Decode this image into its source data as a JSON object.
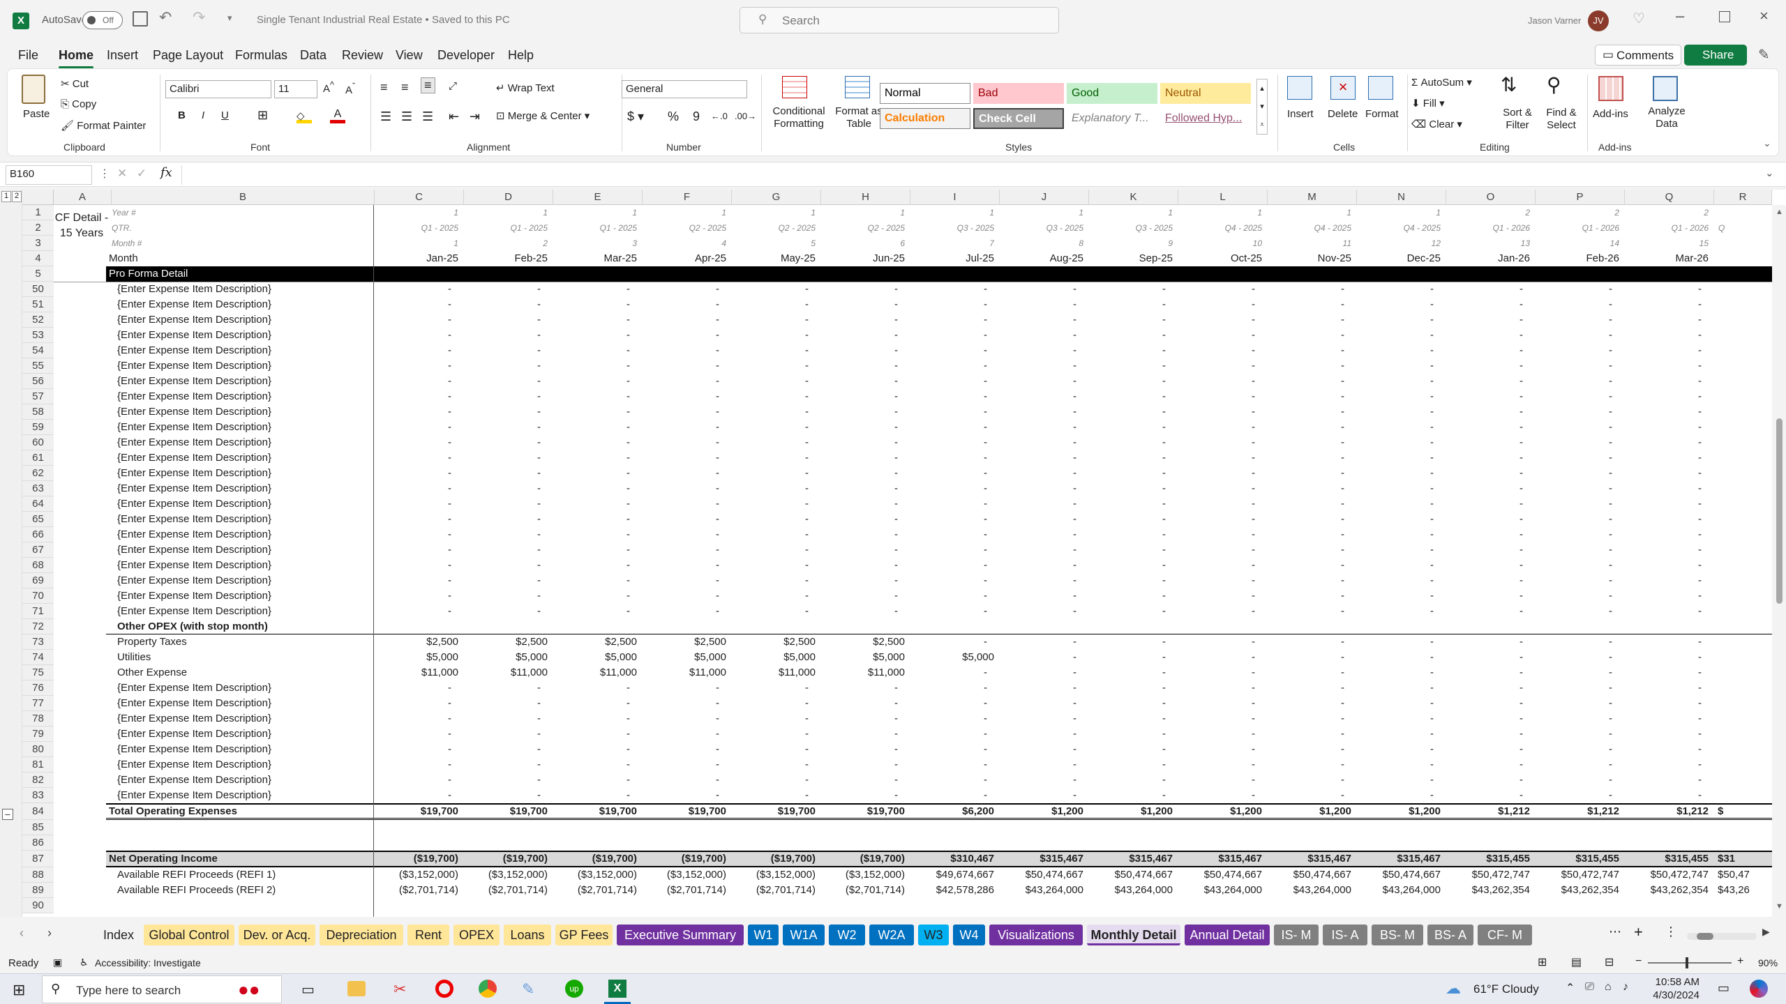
{
  "titlebar": {
    "autosave_label": "AutoSave",
    "autosave_state": "Off",
    "doc_title": "Single Tenant Industrial Real Estate • Saved to this PC",
    "search_placeholder": "Search",
    "user_name": "Jason Varner",
    "user_initials": "JV"
  },
  "menu": {
    "items": [
      "File",
      "Home",
      "Insert",
      "Page Layout",
      "Formulas",
      "Data",
      "Review",
      "View",
      "Developer",
      "Help"
    ],
    "active": "Home",
    "comments_label": "Comments",
    "share_label": "Share"
  },
  "ribbon": {
    "clipboard": {
      "paste": "Paste",
      "cut": "Cut",
      "copy": "Copy",
      "format_painter": "Format Painter",
      "group": "Clipboard"
    },
    "font": {
      "name": "Calibri",
      "size": "11",
      "group": "Font"
    },
    "alignment": {
      "wrap": "Wrap Text",
      "merge": "Merge & Center",
      "group": "Alignment"
    },
    "number": {
      "format": "General",
      "group": "Number"
    },
    "styles": {
      "conditional": "Conditional Formatting",
      "format_table": "Format as Table",
      "items": [
        {
          "label": "Normal",
          "bg": "#ffffff",
          "fg": "#000000",
          "border": "#888888"
        },
        {
          "label": "Bad",
          "bg": "#ffc7ce",
          "fg": "#9c0006",
          "border": "#ffc7ce"
        },
        {
          "label": "Good",
          "bg": "#c6efce",
          "fg": "#006100",
          "border": "#c6efce"
        },
        {
          "label": "Neutral",
          "bg": "#ffeb9c",
          "fg": "#9c5700",
          "border": "#ffeb9c"
        },
        {
          "label": "Calculation",
          "bg": "#f2f2f2",
          "fg": "#fa7d00",
          "border": "#7f7f7f"
        },
        {
          "label": "Check Cell",
          "bg": "#a5a5a5",
          "fg": "#ffffff",
          "border": "#3f3f3f"
        },
        {
          "label": "Explanatory T...",
          "bg": "#ffffff",
          "fg": "#7f7f7f",
          "border": "#ffffff"
        },
        {
          "label": "Followed Hyp...",
          "bg": "#ffffff",
          "fg": "#954f72",
          "border": "#ffffff"
        }
      ],
      "group": "Styles"
    },
    "cells": {
      "insert": "Insert",
      "delete": "Delete",
      "format": "Format",
      "group": "Cells"
    },
    "editing": {
      "autosum": "AutoSum",
      "fill": "Fill",
      "clear": "Clear",
      "sort": "Sort & Filter",
      "find": "Find & Select",
      "group": "Editing"
    },
    "addins": {
      "addins": "Add-ins",
      "analyze": "Analyze Data",
      "group": "Add-ins"
    }
  },
  "formula_bar": {
    "name_box": "B160",
    "formula": ""
  },
  "grid": {
    "columns": [
      "A",
      "B",
      "C",
      "D",
      "E",
      "F",
      "G",
      "H",
      "I",
      "J",
      "K",
      "L",
      "M",
      "N",
      "O",
      "P",
      "Q",
      "R"
    ],
    "a_label": "CF Detail - 15 Years",
    "header_labels": [
      "Year #",
      "QTR.",
      "Month #",
      "Month"
    ],
    "section_title": "Pro Forma Detail",
    "year": [
      "1",
      "1",
      "1",
      "1",
      "1",
      "1",
      "1",
      "1",
      "1",
      "1",
      "1",
      "1",
      "2",
      "2",
      "2"
    ],
    "qtr": [
      "Q1 - 2025",
      "Q1 - 2025",
      "Q1 - 2025",
      "Q2 - 2025",
      "Q2 - 2025",
      "Q2 - 2025",
      "Q3 - 2025",
      "Q3 - 2025",
      "Q3 - 2025",
      "Q4 - 2025",
      "Q4 - 2025",
      "Q4 - 2025",
      "Q1 - 2026",
      "Q1 - 2026",
      "Q1 - 2026"
    ],
    "month_num": [
      "1",
      "2",
      "3",
      "4",
      "5",
      "6",
      "7",
      "8",
      "9",
      "10",
      "11",
      "12",
      "13",
      "14",
      "15"
    ],
    "month": [
      "Jan-25",
      "Feb-25",
      "Mar-25",
      "Apr-25",
      "May-25",
      "Jun-25",
      "Jul-25",
      "Aug-25",
      "Sep-25",
      "Oct-25",
      "Nov-25",
      "Dec-25",
      "Jan-26",
      "Feb-26",
      "Mar-26"
    ],
    "expense_placeholder": "{Enter Expense Item Description}",
    "other_opex_title": "Other OPEX (with stop month)",
    "property_taxes": {
      "label": "Property Taxes",
      "values": [
        "$2,500",
        "$2,500",
        "$2,500",
        "$2,500",
        "$2,500",
        "$2,500",
        "-",
        "-",
        "-",
        "-",
        "-",
        "-",
        "-",
        "-",
        "-"
      ]
    },
    "utilities": {
      "label": "Utilities",
      "values": [
        "$5,000",
        "$5,000",
        "$5,000",
        "$5,000",
        "$5,000",
        "$5,000",
        "$5,000",
        "-",
        "-",
        "-",
        "-",
        "-",
        "-",
        "-",
        "-"
      ]
    },
    "other_expense": {
      "label": "Other Expense",
      "values": [
        "$11,000",
        "$11,000",
        "$11,000",
        "$11,000",
        "$11,000",
        "$11,000",
        "-",
        "-",
        "-",
        "-",
        "-",
        "-",
        "-",
        "-",
        "-"
      ]
    },
    "total_opex": {
      "label": "Total Operating Expenses",
      "values": [
        "$19,700",
        "$19,700",
        "$19,700",
        "$19,700",
        "$19,700",
        "$19,700",
        "$6,200",
        "$1,200",
        "$1,200",
        "$1,200",
        "$1,200",
        "$1,200",
        "$1,212",
        "$1,212",
        "$1,212"
      ],
      "overflow": "$"
    },
    "noi": {
      "label": "Net Operating Income",
      "values": [
        "($19,700)",
        "($19,700)",
        "($19,700)",
        "($19,700)",
        "($19,700)",
        "($19,700)",
        "$310,467",
        "$315,467",
        "$315,467",
        "$315,467",
        "$315,467",
        "$315,467",
        "$315,455",
        "$315,455",
        "$315,455"
      ],
      "overflow": "$31"
    },
    "refi1": {
      "label": "Available REFI Proceeds (REFI 1)",
      "values": [
        "($3,152,000)",
        "($3,152,000)",
        "($3,152,000)",
        "($3,152,000)",
        "($3,152,000)",
        "($3,152,000)",
        "$49,674,667",
        "$50,474,667",
        "$50,474,667",
        "$50,474,667",
        "$50,474,667",
        "$50,474,667",
        "$50,472,747",
        "$50,472,747",
        "$50,472,747"
      ],
      "overflow": "$50,47"
    },
    "refi2": {
      "label": "Available REFI Proceeds (REFI 2)",
      "values": [
        "($2,701,714)",
        "($2,701,714)",
        "($2,701,714)",
        "($2,701,714)",
        "($2,701,714)",
        "($2,701,714)",
        "$42,578,286",
        "$43,264,000",
        "$43,264,000",
        "$43,264,000",
        "$43,264,000",
        "$43,264,000",
        "$43,262,354",
        "$43,262,354",
        "$43,262,354"
      ],
      "overflow": "$43,26"
    },
    "dash": "-"
  },
  "tabs": [
    {
      "label": "Index",
      "bg": "#f3f3f3",
      "fg": "#222"
    },
    {
      "label": "Global Control",
      "bg": "#ffe699",
      "fg": "#222"
    },
    {
      "label": "Dev. or Acq.",
      "bg": "#ffe699",
      "fg": "#222"
    },
    {
      "label": "Depreciation",
      "bg": "#ffe699",
      "fg": "#222"
    },
    {
      "label": "Rent",
      "bg": "#ffe699",
      "fg": "#222"
    },
    {
      "label": "OPEX",
      "bg": "#ffe699",
      "fg": "#222"
    },
    {
      "label": "Loans",
      "bg": "#ffe699",
      "fg": "#222"
    },
    {
      "label": "GP Fees",
      "bg": "#ffe699",
      "fg": "#222"
    },
    {
      "label": "Executive Summary",
      "bg": "#7030a0",
      "fg": "#fff"
    },
    {
      "label": "W1",
      "bg": "#0070c0",
      "fg": "#fff"
    },
    {
      "label": "W1A",
      "bg": "#0070c0",
      "fg": "#fff"
    },
    {
      "label": "W2",
      "bg": "#0070c0",
      "fg": "#fff"
    },
    {
      "label": "W2A",
      "bg": "#0070c0",
      "fg": "#fff"
    },
    {
      "label": "W3",
      "bg": "#00b0f0",
      "fg": "#222"
    },
    {
      "label": "W4",
      "bg": "#0070c0",
      "fg": "#fff"
    },
    {
      "label": "Visualizations",
      "bg": "#7030a0",
      "fg": "#fff"
    },
    {
      "label": "Monthly Detail",
      "bg": "#e6dcf0",
      "fg": "#222"
    },
    {
      "label": "Annual Detail",
      "bg": "#7030a0",
      "fg": "#fff"
    },
    {
      "label": "IS- M",
      "bg": "#808080",
      "fg": "#fff"
    },
    {
      "label": "IS- A",
      "bg": "#808080",
      "fg": "#fff"
    },
    {
      "label": "BS- M",
      "bg": "#808080",
      "fg": "#fff"
    },
    {
      "label": "BS- A",
      "bg": "#808080",
      "fg": "#fff"
    },
    {
      "label": "CF- M",
      "bg": "#808080",
      "fg": "#fff"
    }
  ],
  "status": {
    "ready": "Ready",
    "accessibility": "Accessibility: Investigate",
    "zoom": "90%"
  },
  "taskbar": {
    "search_placeholder": "Type here to search",
    "weather": "61°F  Cloudy",
    "time": "10:58 AM",
    "date": "4/30/2024"
  }
}
